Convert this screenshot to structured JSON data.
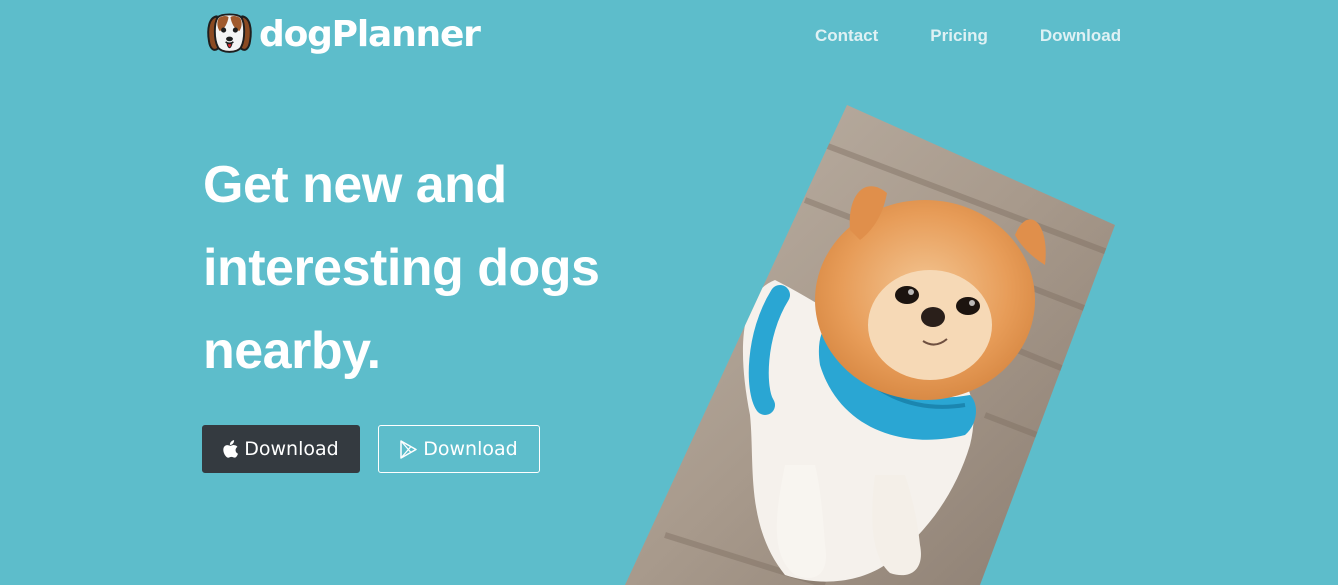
{
  "header": {
    "brand_name": "dogPlanner",
    "logo_icon": "beagle-face-icon",
    "nav": [
      {
        "label": "Contact"
      },
      {
        "label": "Pricing"
      },
      {
        "label": "Download"
      }
    ]
  },
  "hero": {
    "headline": "Get new and interesting dogs nearby.",
    "buttons": {
      "apple_label": "Download",
      "apple_icon": "apple-icon",
      "play_label": "Download",
      "play_icon": "play-store-icon"
    }
  },
  "colors": {
    "background": "#5dbdcb",
    "dark_button": "#343a40",
    "nav_text": "#dff1f4",
    "text": "#ffffff"
  }
}
